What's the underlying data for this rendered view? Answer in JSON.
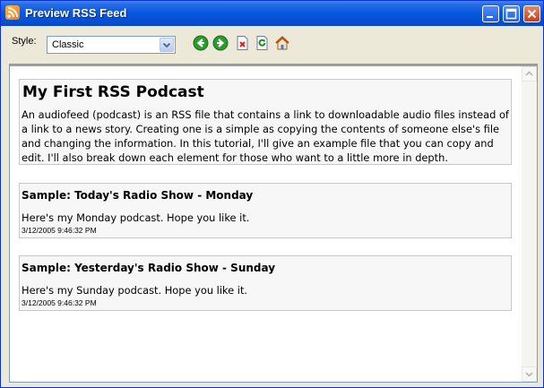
{
  "window": {
    "title": "Preview RSS Feed"
  },
  "toolbar": {
    "style_label": "Style:",
    "style_value": "Classic",
    "tools": [
      "back-icon",
      "forward-icon",
      "delete-icon",
      "refresh-icon",
      "home-icon"
    ]
  },
  "channel": {
    "title": "My First RSS Podcast",
    "description": "An audiofeed (podcast) is an RSS file that contains a link to downloadable audio files instead of a link to a news story. Creating one is a simple as copying the contents of someone else's file and changing the information. In this tutorial, I'll give an example file that you can copy and edit. I'll also break down each element for those who want to a little more in depth."
  },
  "items": [
    {
      "title": "Sample: Today's Radio Show - Monday",
      "description": "Here's my Monday podcast. Hope you like it.",
      "date": "3/12/2005 9:46:32 PM"
    },
    {
      "title": "Sample: Yesterday's Radio Show - Sunday",
      "description": "Here's my Sunday podcast. Hope you like it.",
      "date": "3/12/2005 9:46:32 PM"
    }
  ],
  "colors": {
    "titlebar": "#0a58e0",
    "window_bg": "#ece9d8",
    "feed_bg": "#f7f7f7"
  }
}
